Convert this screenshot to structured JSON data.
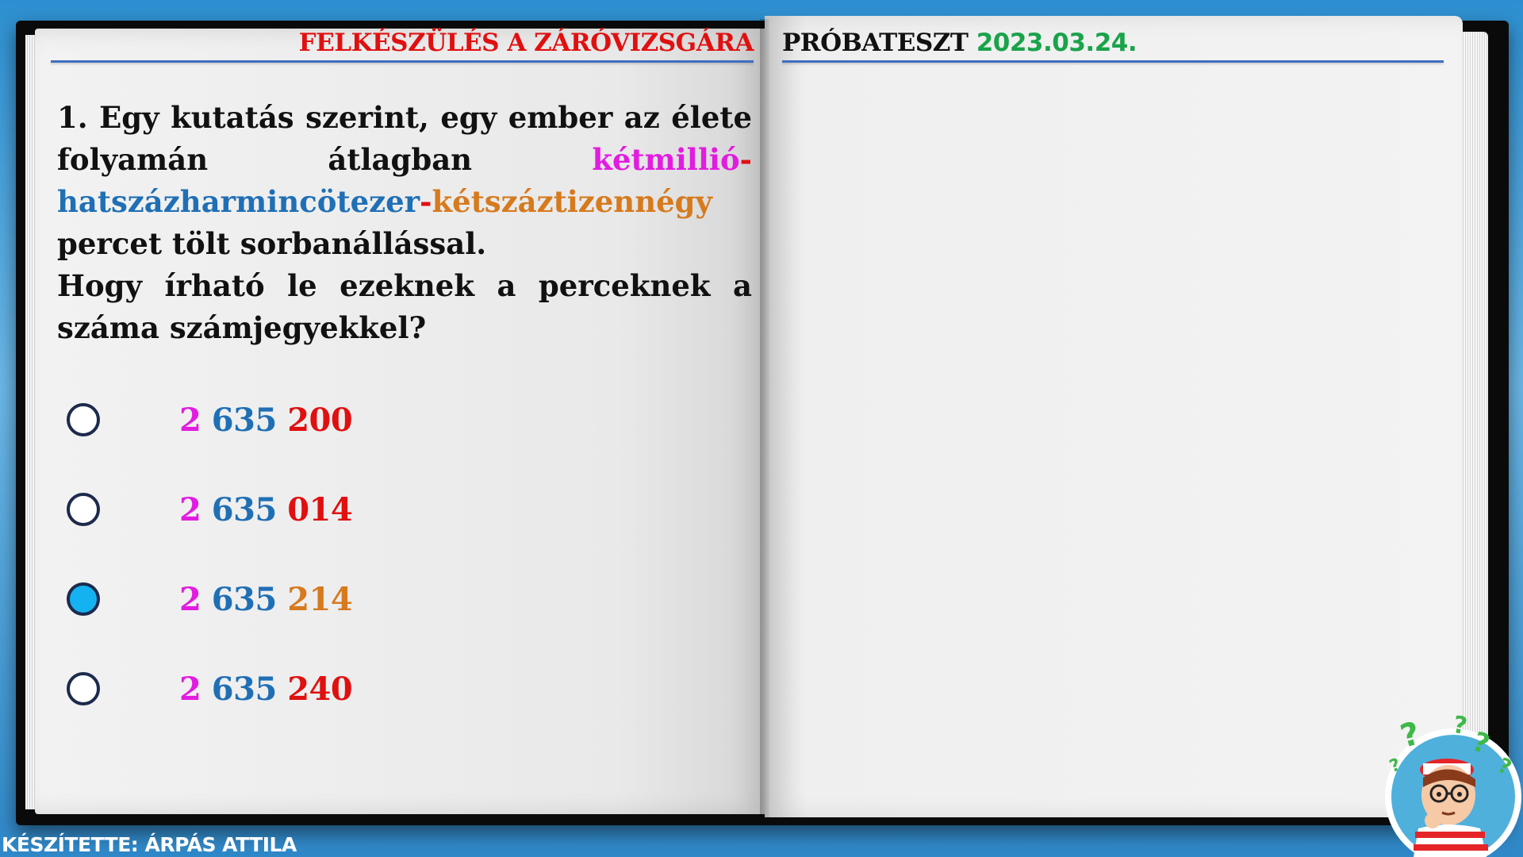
{
  "header": {
    "left_title": "FELKÉSZÜLÉS A ZÁRÓVIZSGÁRA",
    "right_title": "PRÓBATESZT",
    "date": "2023.03.24."
  },
  "question": {
    "intro": "1. Egy kutatás szerint, egy ember az élete folyamán átlagban ",
    "part1": "kétmillió",
    "dash1": "-",
    "part2": "hatszázharmincötezer",
    "dash2": "-",
    "part3": "kétszáztizennégy",
    "outro": " percet tölt sorbanállással.",
    "ask": "Hogy írható le ezeknek a perceknek a száma számjegyekkel?"
  },
  "options": [
    {
      "a": "2",
      "b": "635",
      "c": "200",
      "selected": false,
      "c_color": "#e01010"
    },
    {
      "a": "2",
      "b": "635",
      "c": "014",
      "selected": false,
      "c_color": "#e01010"
    },
    {
      "a": "2",
      "b": "635",
      "c": "214",
      "selected": true,
      "c_color": "#d67a1e"
    },
    {
      "a": "2",
      "b": "635",
      "c": "240",
      "selected": false,
      "c_color": "#e01010"
    }
  ],
  "footer": {
    "author": "KÉSZÍTETTE: ÁRPÁS ATTILA"
  },
  "icons": {
    "mascot": "thinking-character-icon"
  }
}
